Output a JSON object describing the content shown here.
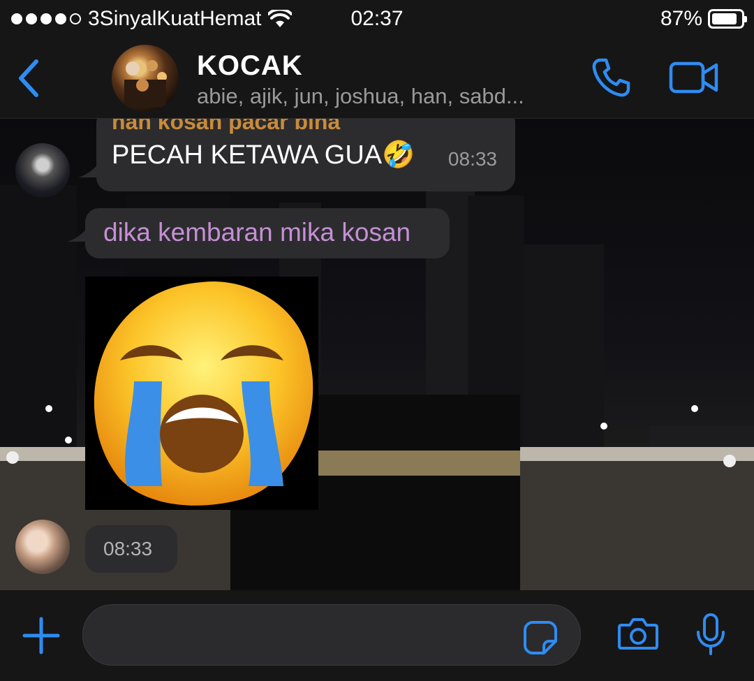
{
  "status_bar": {
    "carrier": "3SinyalKuatHemat",
    "time": "02:37",
    "battery_percent": "87%",
    "battery_level": 0.87,
    "signal_bars_filled": 4,
    "signal_bars_total": 5
  },
  "header": {
    "back_icon": "chevron-left-icon",
    "group_name": "KOCAK",
    "members": "abie, ajik, jun, joshua, han, sabd...",
    "call_icon": "phone-icon",
    "video_icon": "video-camera-icon"
  },
  "messages": [
    {
      "sender": "han kosan pacar bina",
      "text": "PECAH KETAWA GUA🤣",
      "time": "08:33"
    },
    {
      "text": "dika kembaran mika kosan"
    },
    {
      "type": "sticker",
      "sticker_icon": "crying-face-sticker",
      "time": "08:33"
    }
  ],
  "input_bar": {
    "plus_icon": "plus-icon",
    "placeholder": "",
    "sticker_icon": "sticker-icon",
    "camera_icon": "camera-icon",
    "mic_icon": "microphone-icon"
  },
  "colors": {
    "accent": "#2f8cf2",
    "sender_han": "#c98b3b",
    "sender_dika": "#c68fd6",
    "bubble": "#2c2c2e",
    "bar": "#161616"
  }
}
